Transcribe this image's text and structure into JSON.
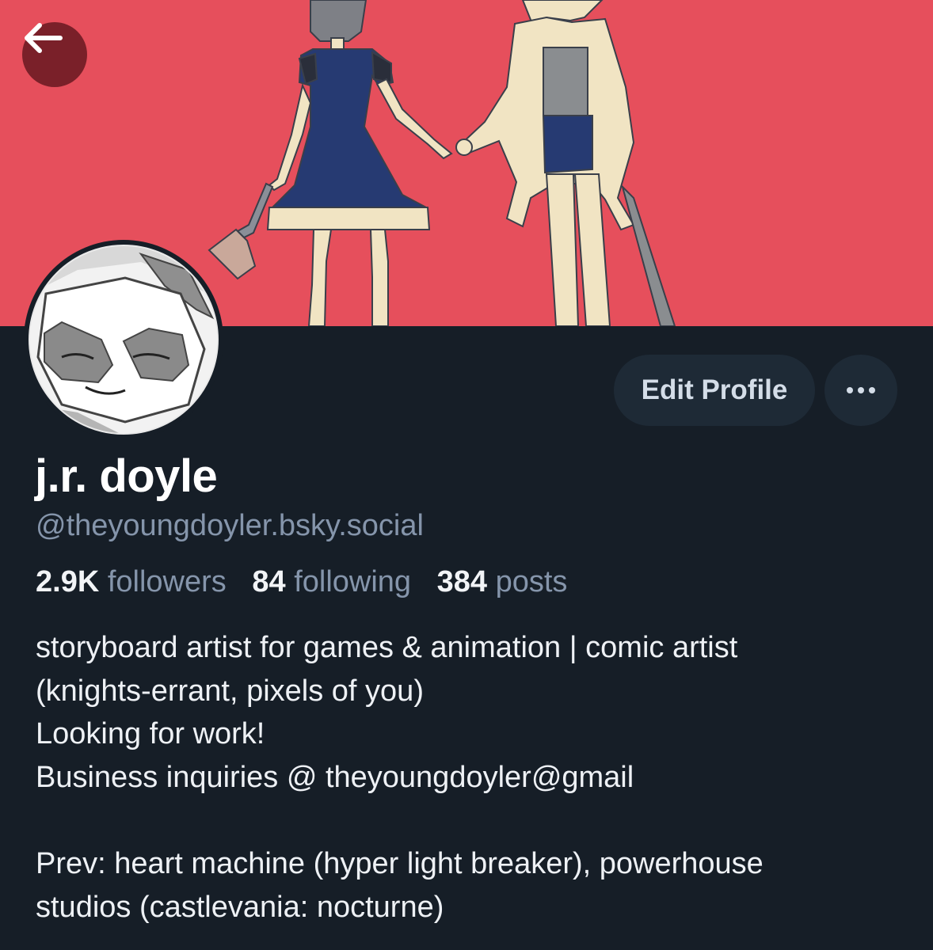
{
  "header": {
    "back_icon": "arrow-left-icon",
    "back_label": "Back"
  },
  "profile": {
    "display_name": "j.r. doyle",
    "handle": "@theyoungdoyler.bsky.social",
    "avatar_icon": "raccoon-avatar"
  },
  "actions": {
    "edit_label": "Edit Profile",
    "more_icon": "ellipsis-icon"
  },
  "stats": {
    "followers_count": "2.9K",
    "followers_label": "followers",
    "following_count": "84",
    "following_label": "following",
    "posts_count": "384",
    "posts_label": "posts"
  },
  "bio": {
    "lines": [
      "storyboard artist for games & animation | comic artist",
      "(knights-errant, pixels of you)",
      "Looking for work!",
      "Business inquiries @ theyoungdoyler@gmail",
      "",
      "Prev: heart machine (hyper light breaker), powerhouse",
      "studios (castlevania: nocturne)"
    ]
  },
  "colors": {
    "banner": "#e64f5c",
    "background": "#161e27",
    "button_bg": "#1e2a36",
    "muted_text": "#8595ab"
  }
}
